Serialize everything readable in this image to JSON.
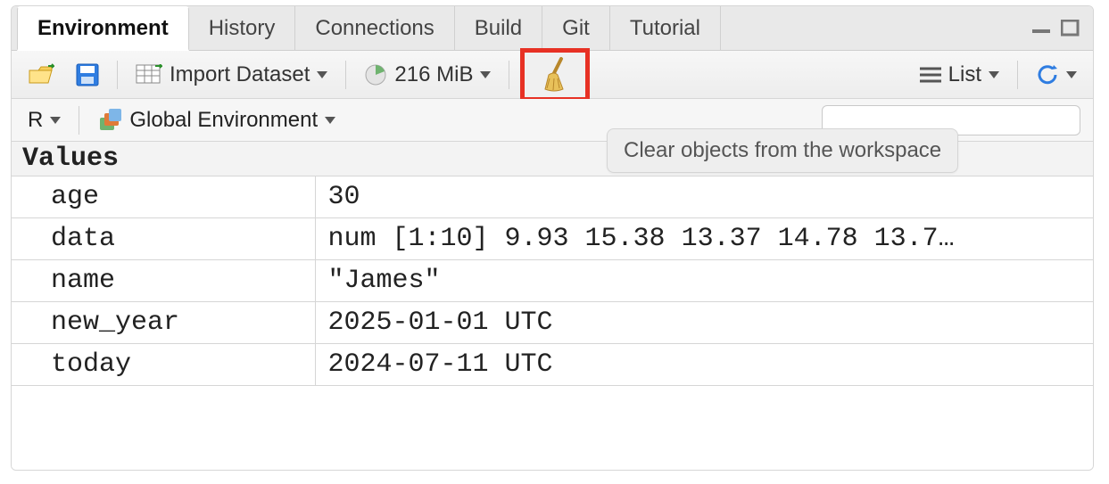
{
  "tabs": {
    "items": [
      "Environment",
      "History",
      "Connections",
      "Build",
      "Git",
      "Tutorial"
    ],
    "active_index": 0
  },
  "toolbar1": {
    "import_label": "Import Dataset",
    "memory": "216 MiB",
    "view_label": "List"
  },
  "toolbar2": {
    "language_label": "R",
    "scope_label": "Global Environment"
  },
  "tooltip": "Clear objects from the workspace",
  "section_header": "Values",
  "values": [
    {
      "name": "age",
      "value": "30"
    },
    {
      "name": "data",
      "value": "num [1:10] 9.93 15.38 13.37 14.78 13.7…"
    },
    {
      "name": "name",
      "value": "\"James\""
    },
    {
      "name": "new_year",
      "value": "2025-01-01 UTC"
    },
    {
      "name": "today",
      "value": "2024-07-11 UTC"
    }
  ],
  "icons": {
    "open": "open-folder-icon",
    "save": "save-icon",
    "import": "import-dataset-icon",
    "memory": "pie-memory-icon",
    "broom": "broom-icon",
    "list": "list-lines-icon",
    "refresh": "refresh-icon",
    "minimize": "minimize-icon",
    "maximize": "maximize-icon",
    "stack": "color-stack-icon",
    "search": "search-icon"
  }
}
